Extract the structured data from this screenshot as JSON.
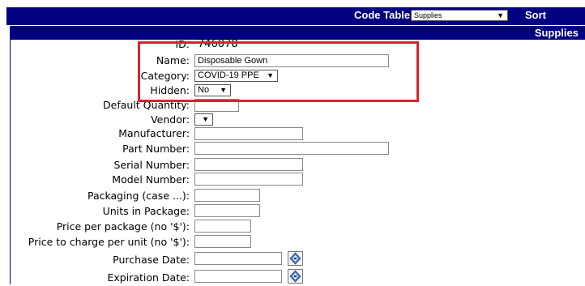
{
  "header": {
    "code_table_label": "Code Table:",
    "code_table_value": "Supplies",
    "sort_label": "Sort"
  },
  "section": {
    "title": "Supplies"
  },
  "form": {
    "id_label": "ID:",
    "id_value": "746078",
    "name_label": "Name:",
    "name_value": "Disposable Gown",
    "category_label": "Category:",
    "category_value": "COVID-19 PPE",
    "hidden_label": "Hidden:",
    "hidden_value": "No",
    "default_quantity_label": "Default Quantity:",
    "vendor_label": "Vendor:",
    "manufacturer_label": "Manufacturer:",
    "part_number_label": "Part Number:",
    "serial_number_label": "Serial Number:",
    "model_number_label": "Model Number:",
    "packaging_label": "Packaging (case ...):",
    "units_label": "Units in Package:",
    "price_package_label": "Price per package (no '$'):",
    "price_unit_label": "Price to charge per unit (no '$'):",
    "purchase_date_label": "Purchase Date:",
    "expiration_date_label": "Expiration Date:"
  },
  "colors": {
    "header_bg": "#000080",
    "highlight_border": "#e0202e"
  },
  "icons": {
    "dropdown": "triangle-down",
    "calendar": "calendar-picker-icon"
  }
}
